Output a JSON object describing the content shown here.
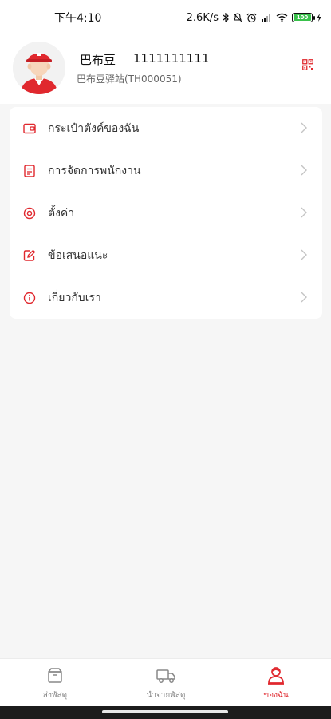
{
  "status_bar": {
    "time": "下午4:10",
    "network_speed": "2.6K/s",
    "battery_level": "100",
    "icons": [
      "bluetooth-icon",
      "mute-icon",
      "alarm-icon",
      "signal-icon",
      "wifi-icon",
      "battery-icon",
      "charging-icon"
    ]
  },
  "profile": {
    "name": "巴布豆",
    "phone": "1111111111",
    "station": "巴布豆驿站(TH000051)",
    "qr_icon": "qr-code-icon"
  },
  "menu": {
    "items": [
      {
        "label": "กระเป๋าตังค์ของฉัน",
        "icon": "wallet-icon"
      },
      {
        "label": "การจัดการพนักงาน",
        "icon": "staff-list-icon"
      },
      {
        "label": "ตั้งค่า",
        "icon": "settings-icon"
      },
      {
        "label": "ข้อเสนอแนะ",
        "icon": "feedback-icon"
      },
      {
        "label": "เกี่ยวกับเรา",
        "icon": "info-icon"
      }
    ]
  },
  "bottom_nav": {
    "tabs": [
      {
        "label": "ส่งพัสดุ",
        "icon": "package-box-icon",
        "active": false
      },
      {
        "label": "นำจ่ายพัสดุ",
        "icon": "delivery-truck-icon",
        "active": false
      },
      {
        "label": "ของฉัน",
        "icon": "profile-icon",
        "active": true
      }
    ]
  },
  "colors": {
    "accent": "#e0282e",
    "background": "#f6f6f6",
    "card": "#ffffff",
    "text_primary": "#222222",
    "text_secondary": "#666666"
  }
}
